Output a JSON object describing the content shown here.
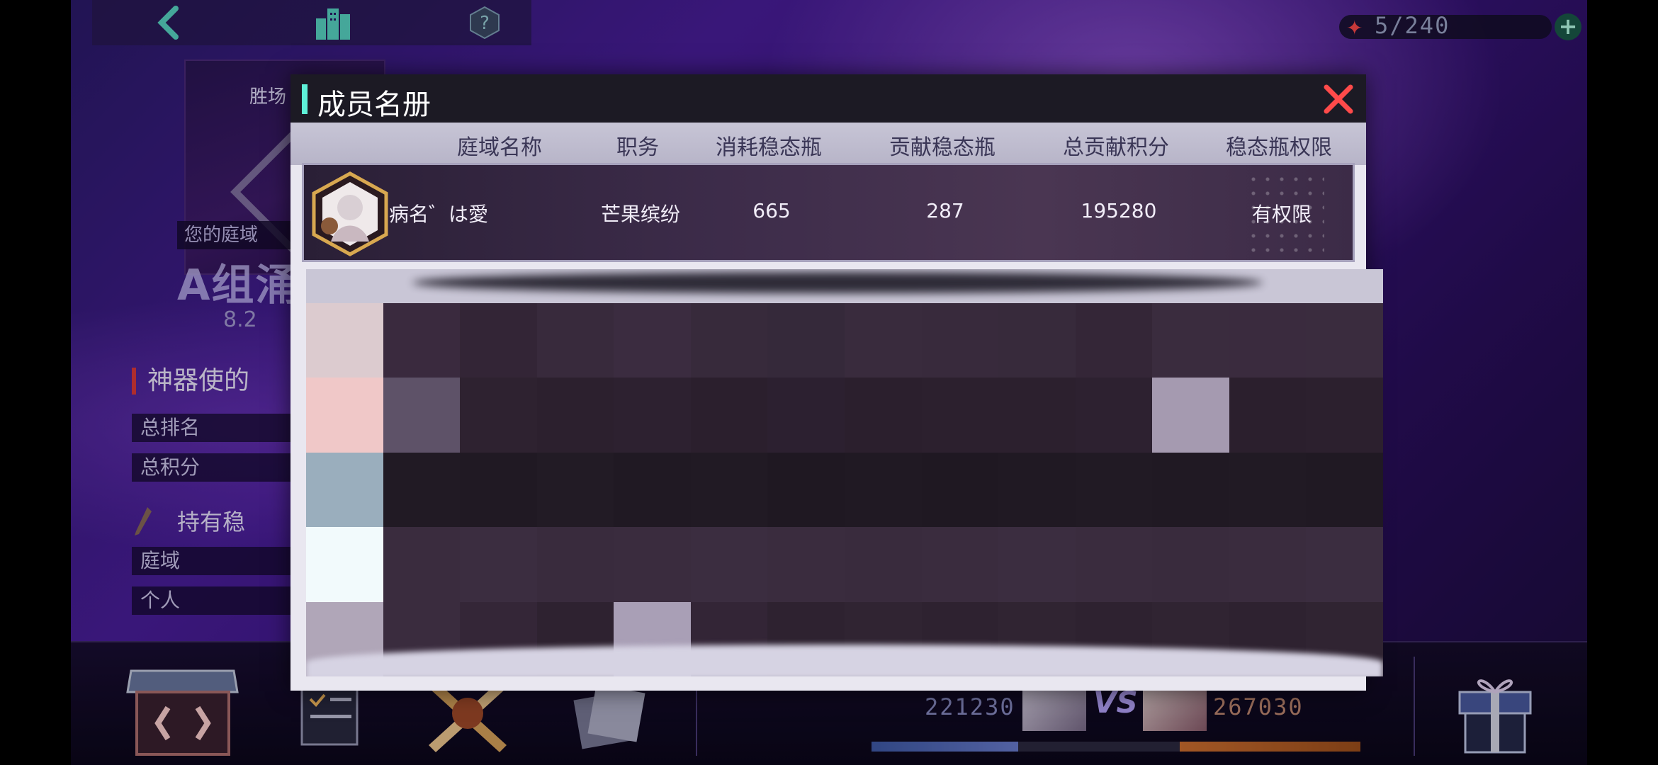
{
  "hud": {
    "energy": "5/240",
    "energy_plus": "+"
  },
  "left_panel": {
    "card_win": "胜场",
    "card_footer": "您的庭域",
    "team_name": "A组涌",
    "team_sub": "8.2",
    "section_title": "神器使的",
    "stats": [
      {
        "label": "总排名"
      },
      {
        "label": "总积分"
      }
    ],
    "hold_title": "持有稳",
    "hold_rows": [
      {
        "label": "庭域"
      },
      {
        "label": "个人"
      }
    ]
  },
  "bottom": {
    "score_left": "221230",
    "score_right": "267030",
    "vs": "VS",
    "progress_left": 0.3,
    "progress_right": 0.37
  },
  "modal": {
    "title": "成员名册",
    "columns": [
      "庭域名称",
      "职务",
      "消耗稳态瓶",
      "贡献稳态瓶",
      "总贡献积分",
      "稳态瓶权限"
    ],
    "members": [
      {
        "name": "病名゛は愛",
        "role": "芒果缤纷",
        "consumed": "665",
        "contributed": "287",
        "total_points": "195280",
        "permission": "有权限"
      }
    ]
  },
  "colors": {
    "accent_teal": "#5ef0d8",
    "close_red": "#ff4a4a",
    "modal_bg": "#e9e7f0"
  }
}
